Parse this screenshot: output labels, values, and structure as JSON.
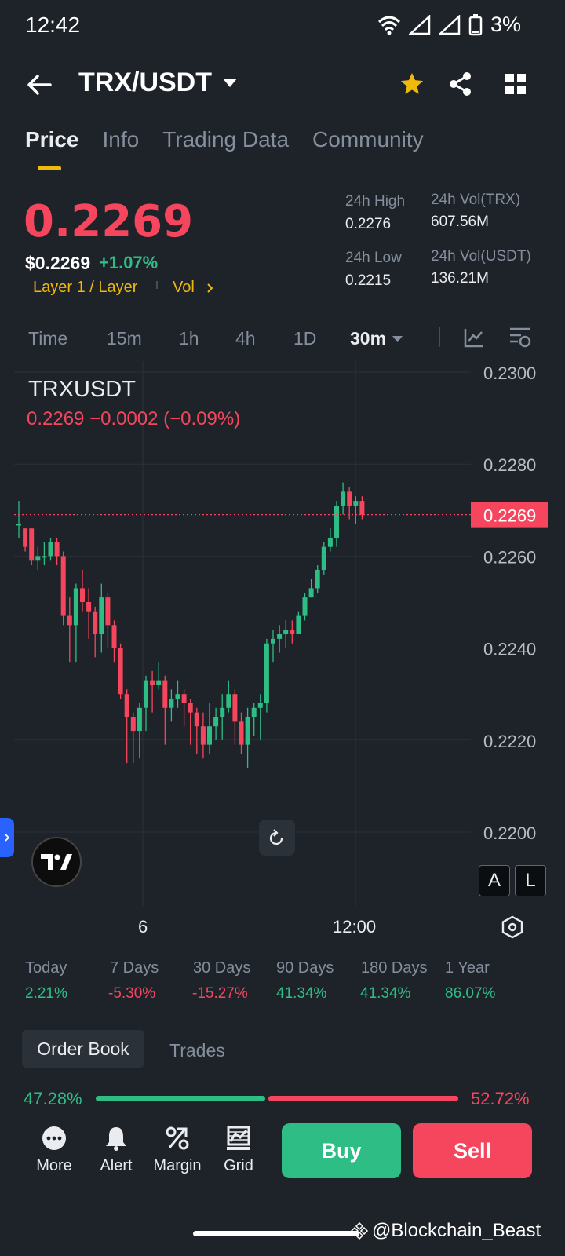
{
  "status": {
    "time": "12:42",
    "battery": "3%"
  },
  "header": {
    "pair": "TRX/USDT"
  },
  "tabs": [
    "Price",
    "Info",
    "Trading Data",
    "Community"
  ],
  "price": {
    "last": "0.2269",
    "usd": "$0.2269",
    "change": "+1.07%",
    "tag1": "Layer 1 / Layer",
    "tag2": "Vol",
    "high_label": "24h High",
    "high": "0.2276",
    "low_label": "24h Low",
    "low": "0.2215",
    "vol_trx_label": "24h Vol(TRX)",
    "vol_trx": "607.56M",
    "vol_usdt_label": "24h Vol(USDT)",
    "vol_usdt": "136.21M"
  },
  "intervals": [
    "Time",
    "15m",
    "1h",
    "4h",
    "1D",
    "30m"
  ],
  "chart": {
    "symbol": "TRXUSDT",
    "ohlc": "0.2269  −0.0002 (−0.09%)",
    "current_label": "0.2269",
    "x_labels": [
      "6",
      "12:00"
    ],
    "btn_a": "A",
    "btn_l": "L"
  },
  "chart_data": {
    "type": "candlestick",
    "y_ticks": [
      "0.2300",
      "0.2280",
      "0.2260",
      "0.2240",
      "0.2220",
      "0.2200"
    ],
    "ylim": [
      0.22,
      0.23
    ],
    "current_price": 0.2269,
    "candles": [
      [
        0.2267,
        0.2267,
        0.2272,
        0.2264
      ],
      [
        0.2266,
        0.2262,
        0.2266,
        0.2261
      ],
      [
        0.2266,
        0.2259,
        0.2266,
        0.2258
      ],
      [
        0.2259,
        0.226,
        0.2262,
        0.2257
      ],
      [
        0.226,
        0.226,
        0.2263,
        0.2258
      ],
      [
        0.226,
        0.2263,
        0.2264,
        0.2259
      ],
      [
        0.2263,
        0.226,
        0.2264,
        0.2258
      ],
      [
        0.226,
        0.2247,
        0.2261,
        0.2245
      ],
      [
        0.2247,
        0.2245,
        0.2251,
        0.2237
      ],
      [
        0.2245,
        0.2253,
        0.2254,
        0.2237
      ],
      [
        0.2253,
        0.225,
        0.2257,
        0.2248
      ],
      [
        0.225,
        0.2248,
        0.2253,
        0.2242
      ],
      [
        0.2248,
        0.2243,
        0.2249,
        0.2238
      ],
      [
        0.2243,
        0.2251,
        0.2254,
        0.2239
      ],
      [
        0.2251,
        0.2245,
        0.2252,
        0.224
      ],
      [
        0.2245,
        0.224,
        0.2246,
        0.2237
      ],
      [
        0.224,
        0.223,
        0.2241,
        0.2229
      ],
      [
        0.223,
        0.2225,
        0.2231,
        0.2215
      ],
      [
        0.2225,
        0.2222,
        0.2226,
        0.2215
      ],
      [
        0.2222,
        0.2227,
        0.2228,
        0.2216
      ],
      [
        0.2227,
        0.2233,
        0.2234,
        0.2222
      ],
      [
        0.2233,
        0.2232,
        0.2235,
        0.2226
      ],
      [
        0.2232,
        0.2233,
        0.2237,
        0.2231
      ],
      [
        0.2233,
        0.2227,
        0.2234,
        0.2219
      ],
      [
        0.2227,
        0.2229,
        0.2231,
        0.2224
      ],
      [
        0.2229,
        0.223,
        0.2233,
        0.2227
      ],
      [
        0.223,
        0.2228,
        0.2231,
        0.2223
      ],
      [
        0.2228,
        0.2226,
        0.2229,
        0.2219
      ],
      [
        0.2226,
        0.2223,
        0.2227,
        0.2217
      ],
      [
        0.2223,
        0.2219,
        0.2226,
        0.2216
      ],
      [
        0.2219,
        0.2223,
        0.2228,
        0.2217
      ],
      [
        0.2223,
        0.2225,
        0.2227,
        0.222
      ],
      [
        0.2225,
        0.2227,
        0.223,
        0.222
      ],
      [
        0.2227,
        0.223,
        0.2233,
        0.2226
      ],
      [
        0.223,
        0.2224,
        0.2231,
        0.2219
      ],
      [
        0.2224,
        0.2219,
        0.2226,
        0.2217
      ],
      [
        0.2219,
        0.2225,
        0.2227,
        0.2214
      ],
      [
        0.2225,
        0.2227,
        0.2228,
        0.2221
      ],
      [
        0.2227,
        0.2228,
        0.223,
        0.222
      ],
      [
        0.2228,
        0.2241,
        0.2242,
        0.2226
      ],
      [
        0.2241,
        0.2242,
        0.2244,
        0.2237
      ],
      [
        0.2242,
        0.2243,
        0.2245,
        0.2239
      ],
      [
        0.2243,
        0.2244,
        0.2246,
        0.224
      ],
      [
        0.2244,
        0.2243,
        0.2246,
        0.2241
      ],
      [
        0.2243,
        0.2247,
        0.2248,
        0.2243
      ],
      [
        0.2247,
        0.2251,
        0.2252,
        0.2246
      ],
      [
        0.2251,
        0.2253,
        0.2255,
        0.2251
      ],
      [
        0.2253,
        0.2257,
        0.2258,
        0.2252
      ],
      [
        0.2257,
        0.2262,
        0.2263,
        0.2256
      ],
      [
        0.2262,
        0.2264,
        0.2266,
        0.2261
      ],
      [
        0.2264,
        0.2271,
        0.2272,
        0.2262
      ],
      [
        0.2271,
        0.2274,
        0.2276,
        0.2269
      ],
      [
        0.2274,
        0.2271,
        0.2275,
        0.2268
      ],
      [
        0.2271,
        0.2272,
        0.2273,
        0.2267
      ],
      [
        0.2272,
        0.2269,
        0.2273,
        0.2268
      ]
    ]
  },
  "performance": [
    {
      "label": "Today",
      "value": "2.21%",
      "color": "#2ebd85"
    },
    {
      "label": "7 Days",
      "value": "-5.30%",
      "color": "#f6465d"
    },
    {
      "label": "30 Days",
      "value": "-15.27%",
      "color": "#f6465d"
    },
    {
      "label": "90 Days",
      "value": "41.34%",
      "color": "#2ebd85"
    },
    {
      "label": "180 Days",
      "value": "41.34%",
      "color": "#2ebd85"
    },
    {
      "label": "1 Year",
      "value": "86.07%",
      "color": "#2ebd85"
    }
  ],
  "orderbook": {
    "tab1": "Order Book",
    "tab2": "Trades",
    "buy_pct": "47.28%",
    "sell_pct": "52.72%",
    "buy_ratio": 0.4728
  },
  "nav": {
    "more": "More",
    "alert": "Alert",
    "margin": "Margin",
    "grid": "Grid",
    "buy": "Buy",
    "sell": "Sell"
  },
  "watermark": "@Blockchain_Beast",
  "colors": {
    "up": "#2ebd85",
    "down": "#f6465d",
    "accent": "#f0b90b",
    "bg": "#1e2329"
  }
}
